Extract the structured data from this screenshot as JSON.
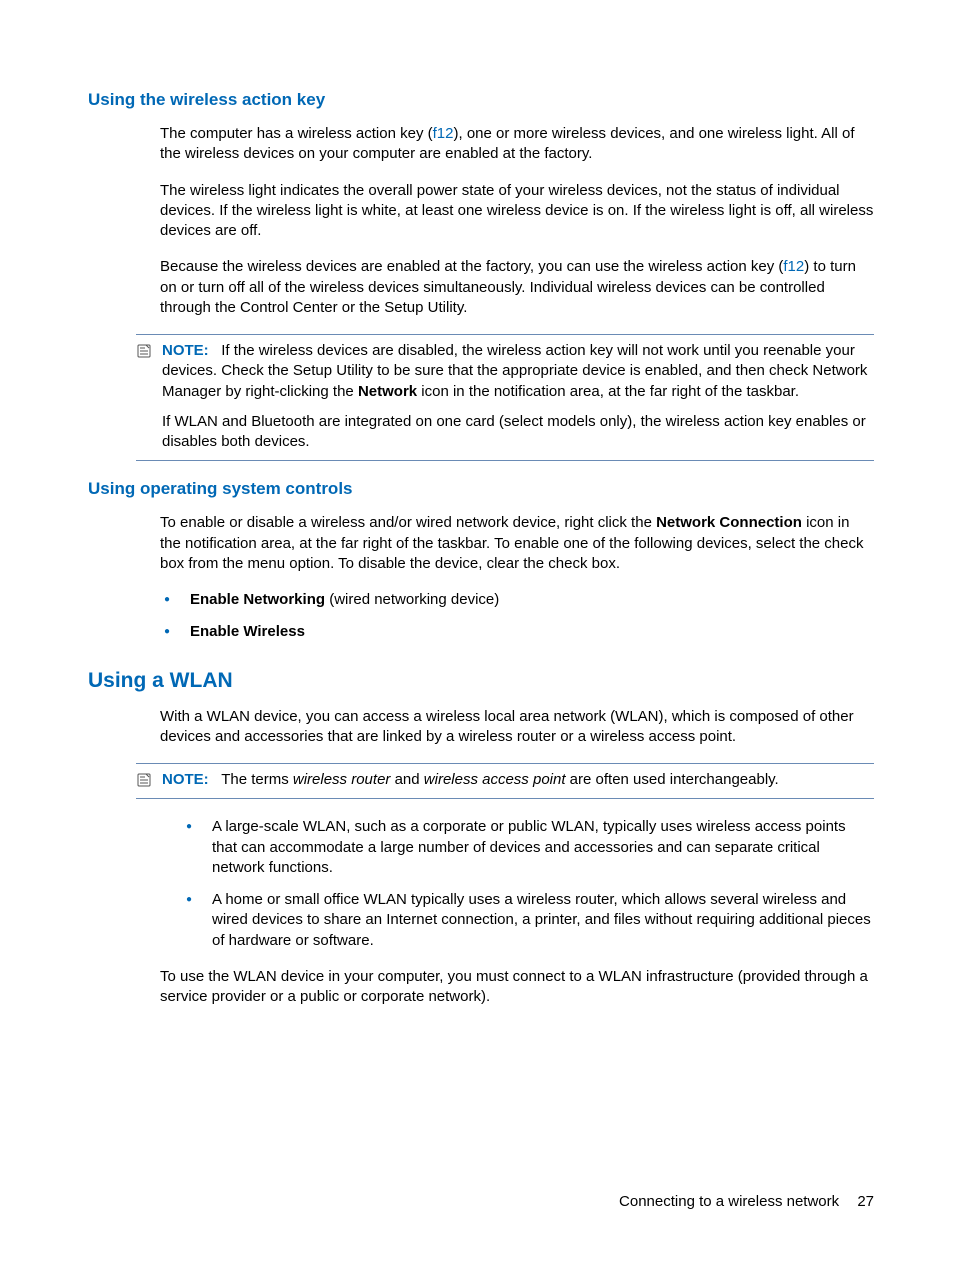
{
  "sections": {
    "wireless_key": {
      "heading": "Using the wireless action key",
      "p1a": "The computer has a wireless action key (",
      "p1_link": "f12",
      "p1b": "), one or more wireless devices, and one wireless light. All of the wireless devices on your computer are enabled at the factory.",
      "p2": "The wireless light indicates the overall power state of your wireless devices, not the status of individual devices. If the wireless light is white, at least one wireless device is on. If the wireless light is off, all wireless devices are off.",
      "p3a": "Because the wireless devices are enabled at the factory, you can use the wireless action key (",
      "p3_link": "f12",
      "p3b": ") to turn on or turn off all of the wireless devices simultaneously. Individual wireless devices can be controlled through the Control Center or the Setup Utility.",
      "note": {
        "label": "NOTE:",
        "body1a": "If the wireless devices are disabled, the wireless action key will not work until you reenable your devices. Check the Setup Utility to be sure that the appropriate device is enabled, and then check Network Manager by right-clicking the ",
        "body1_bold": "Network",
        "body1b": " icon in the notification area, at the far right of the taskbar.",
        "body2": "If WLAN and Bluetooth are integrated on one card (select models only), the wireless action key enables or disables both devices."
      }
    },
    "os_controls": {
      "heading": "Using operating system controls",
      "p1a": "To enable or disable a wireless and/or wired network device, right click the ",
      "p1_bold": "Network Connection",
      "p1b": " icon in the notification area, at the far right of the taskbar. To enable one of the following devices, select the check box from the menu option. To disable the device, clear the check box.",
      "bullets": [
        {
          "bold": "Enable Networking",
          "rest": " (wired networking device)"
        },
        {
          "bold": "Enable Wireless",
          "rest": ""
        }
      ]
    },
    "wlan": {
      "heading": "Using a WLAN",
      "p1": "With a WLAN device, you can access a wireless local area network (WLAN), which is composed of other devices and accessories that are linked by a wireless router or a wireless access point.",
      "note": {
        "label": "NOTE:",
        "pre": "The terms ",
        "i1": "wireless router",
        "mid": " and ",
        "i2": "wireless access point",
        "post": " are often used interchangeably."
      },
      "bullets": [
        "A large-scale WLAN, such as a corporate or public WLAN, typically uses wireless access points that can accommodate a large number of devices and accessories and can separate critical network functions.",
        "A home or small office WLAN typically uses a wireless router, which allows several wireless and wired devices to share an Internet connection, a printer, and files without requiring additional pieces of hardware or software."
      ],
      "p2": "To use the WLAN device in your computer, you must connect to a WLAN infrastructure (provided through a service provider or a public or corporate network)."
    }
  },
  "footer": {
    "text": "Connecting to a wireless network",
    "page": "27"
  }
}
